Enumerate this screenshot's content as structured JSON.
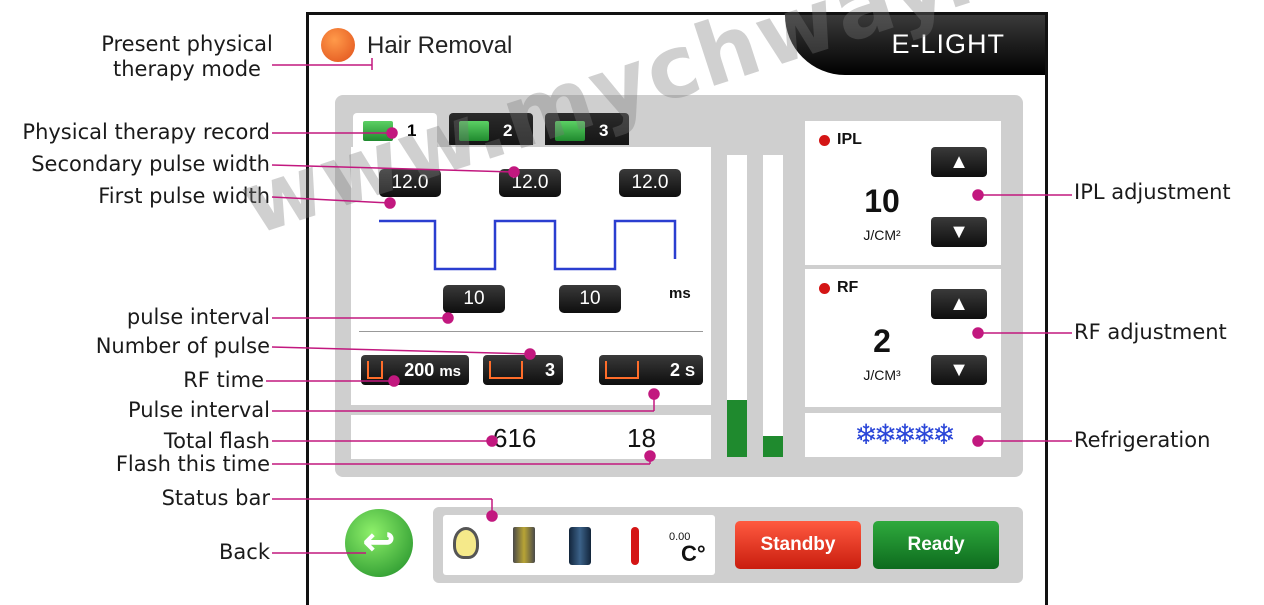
{
  "header": {
    "mode_name": "Hair Removal",
    "brand": "E-LIGHT"
  },
  "tabs": [
    {
      "label": "1"
    },
    {
      "label": "2"
    },
    {
      "label": "3"
    }
  ],
  "pulse": {
    "first_width": "12.0",
    "secondary_width": "12.0",
    "third_width": "12.0",
    "interval_1": "10",
    "interval_2": "10",
    "interval_unit": "ms"
  },
  "controls": {
    "rf_time": "200",
    "rf_time_unit": "ms",
    "pulse_count": "3",
    "pulse_interval": "2",
    "pulse_interval_unit": "S"
  },
  "flash": {
    "total": "616",
    "this_time": "18"
  },
  "gauges": {
    "left_level": 0.19,
    "right_level": 0.07
  },
  "ipl": {
    "label": "IPL",
    "value": "10",
    "unit": "J/CM²"
  },
  "rf": {
    "label": "RF",
    "value": "2",
    "unit": "J/CM³"
  },
  "refrigeration": {
    "level": 5,
    "max": 5,
    "icon": "snowflake-icon"
  },
  "status": {
    "temp_value": "0.00",
    "temp_unit": "C°"
  },
  "buttons": {
    "standby": "Standby",
    "ready": "Ready"
  },
  "colors": {
    "accent_pink": "#c2187f",
    "ready_green": "#1f8a2e",
    "standby_red": "#d8281a",
    "pulse_blue": "#2a3ed0"
  },
  "watermark": "www.mychway.com",
  "annotations": {
    "mode": "Present physical therapy mode",
    "record": "Physical therapy record",
    "secondary_pulse": "Secondary pulse width",
    "first_pulse": "First pulse width",
    "pulse_interval_ms": "pulse interval",
    "num_pulse": "Number of pulse",
    "rf_time": "RF time",
    "pulse_interval_s": "Pulse interval",
    "total_flash": "Total flash",
    "flash_this": "Flash this time",
    "status_bar": "Status bar",
    "back": "Back",
    "ipl_adj": "IPL  adjustment",
    "rf_adj": "RF adjustment",
    "refrigeration": "Refrigeration"
  }
}
